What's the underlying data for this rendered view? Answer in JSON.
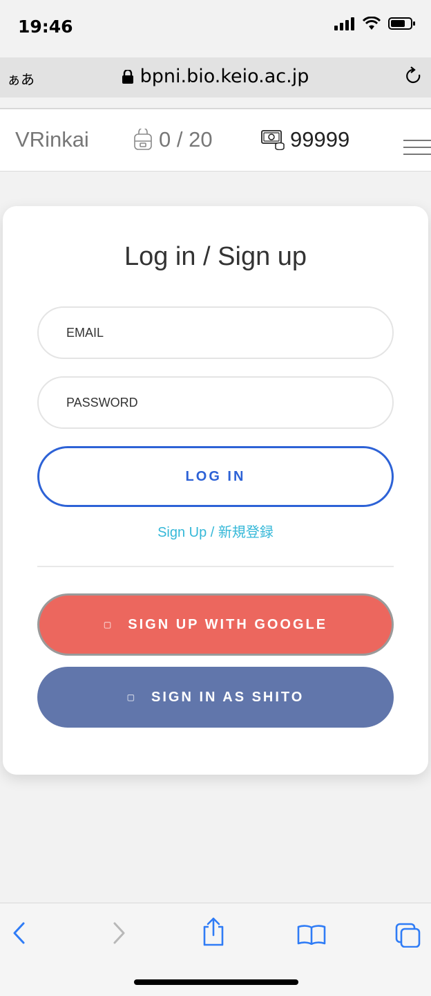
{
  "status_bar": {
    "time": "19:46"
  },
  "browser": {
    "text_size_label": "ぁあ",
    "url": "bpni.bio.keio.ac.jp"
  },
  "nav": {
    "brand": "VRinkai",
    "bag_count": "0 / 20",
    "coins": "99999"
  },
  "login": {
    "title": "Log in / Sign up",
    "email_placeholder": "EMAIL",
    "password_placeholder": "PASSWORD",
    "login_label": "LOG IN",
    "signup_link": "Sign Up / 新規登録",
    "google_label": "SIGN UP WITH GOOGLE",
    "shito_label": "SIGN IN AS SHITO"
  },
  "colors": {
    "login_accent": "#2d62d6",
    "link": "#35b8d8",
    "google": "#ec675e",
    "shito": "#6176ab"
  }
}
